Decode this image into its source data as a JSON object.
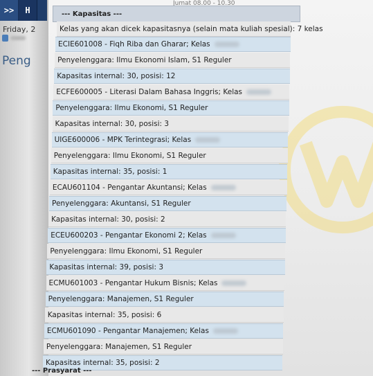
{
  "nav": {
    "forward_label": ">>",
    "tab_label": "H"
  },
  "sidebar": {
    "day_label": "Friday, 2",
    "heading": "Peng"
  },
  "page": {
    "top_text": "Jumat 08.00 - 10.30",
    "section_title": "--- Kapasitas ---",
    "intro": "Kelas yang akan dicek kapasitasnya (selain mata kuliah spesial): 7 kelas",
    "footer_title": "--- Prasyarat ---"
  },
  "rows": [
    {
      "text": "ECIE601008 - Fiqh Riba dan Gharar; Kelas",
      "style": "blue",
      "censor": true
    },
    {
      "text": "Penyelenggara: Ilmu Ekonomi Islam, S1 Reguler",
      "style": "gray"
    },
    {
      "text": "Kapasitas internal: 30, posisi: 12",
      "style": "blue"
    },
    {
      "text": "ECFE600005 - Literasi Dalam Bahasa Inggris; Kelas",
      "style": "gray",
      "censor": true
    },
    {
      "text": "Penyelenggara: Ilmu Ekonomi, S1 Reguler",
      "style": "blue"
    },
    {
      "text": "Kapasitas internal: 30, posisi: 3",
      "style": "gray"
    },
    {
      "text": "UIGE600006 - MPK Terintegrasi; Kelas",
      "style": "blue",
      "censor": true
    },
    {
      "text": "Penyelenggara: Ilmu Ekonomi, S1 Reguler",
      "style": "gray"
    },
    {
      "text": "Kapasitas internal: 35, posisi: 1",
      "style": "blue"
    },
    {
      "text": "ECAU601104 - Pengantar Akuntansi; Kelas",
      "style": "gray",
      "censor": true
    },
    {
      "text": "Penyelenggara: Akuntansi, S1 Reguler",
      "style": "blue"
    },
    {
      "text": "Kapasitas internal: 30, posisi: 2",
      "style": "gray"
    },
    {
      "text": "ECEU600203 - Pengantar Ekonomi 2; Kelas",
      "style": "blue",
      "censor": true
    },
    {
      "text": "Penyelenggara: Ilmu Ekonomi, S1 Reguler",
      "style": "gray"
    },
    {
      "text": "Kapasitas internal: 39, posisi: 3",
      "style": "blue"
    },
    {
      "text": "ECMU601003 - Pengantar Hukum Bisnis; Kelas",
      "style": "gray",
      "censor": true
    },
    {
      "text": "Penyelenggara: Manajemen, S1 Reguler",
      "style": "blue"
    },
    {
      "text": "Kapasitas internal: 35, posisi: 6",
      "style": "gray"
    },
    {
      "text": "ECMU601090 - Pengantar Manajemen; Kelas",
      "style": "blue",
      "censor": true
    },
    {
      "text": "Penyelenggara: Manajemen, S1 Reguler",
      "style": "gray"
    },
    {
      "text": "Kapasitas internal: 35, posisi: 2",
      "style": "blue"
    }
  ],
  "colors": {
    "nav_bg": "#1f3d6a",
    "row_blue": "#d3e2ee",
    "row_gray": "#e8e8e8",
    "heading_blue": "#3a5d86",
    "watermark": "#f5d44a"
  }
}
